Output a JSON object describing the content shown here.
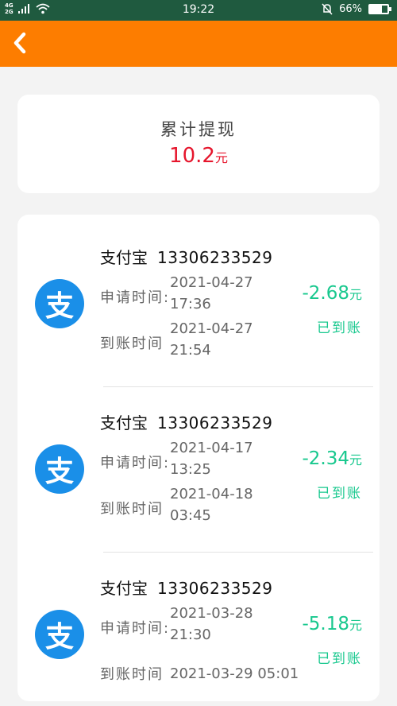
{
  "status_bar": {
    "network_top": "4G",
    "network_bottom": "2G",
    "time": "19:22",
    "battery_text": "66%",
    "battery_level": 0.66
  },
  "app_bar": {
    "back_icon": "chevron-left-icon",
    "color": "#fd7d00"
  },
  "summary": {
    "label": "累计提现",
    "amount": "10.2",
    "unit": "元",
    "amount_color": "#e6162d"
  },
  "records": [
    {
      "channel": "支付宝",
      "account": "13306233529",
      "apply_label": "申请时间:",
      "apply_date": "2021-04-27",
      "apply_time": "17:36",
      "arrive_label": "到账时间",
      "arrive_date": "2021-04-27",
      "arrive_time": "21:54",
      "amount": "-2.68",
      "unit": "元",
      "status": "已到账"
    },
    {
      "channel": "支付宝",
      "account": "13306233529",
      "apply_label": "申请时间:",
      "apply_date": "2021-04-17",
      "apply_time": "13:25",
      "arrive_label": "到账时间",
      "arrive_date": "2021-04-18",
      "arrive_time": "03:45",
      "amount": "-2.34",
      "unit": "元",
      "status": "已到账"
    },
    {
      "channel": "支付宝",
      "account": "13306233529",
      "apply_label": "申请时间:",
      "apply_date": "2021-03-28",
      "apply_time": "21:30",
      "arrive_label": "到账时间",
      "arrive_date": "2021-03-29",
      "arrive_time": "05:01",
      "amount": "-5.18",
      "unit": "元",
      "status": "已到账"
    }
  ],
  "alipay_glyph": "支",
  "accent_green": "#18c88e",
  "alipay_blue": "#1a8fe8"
}
